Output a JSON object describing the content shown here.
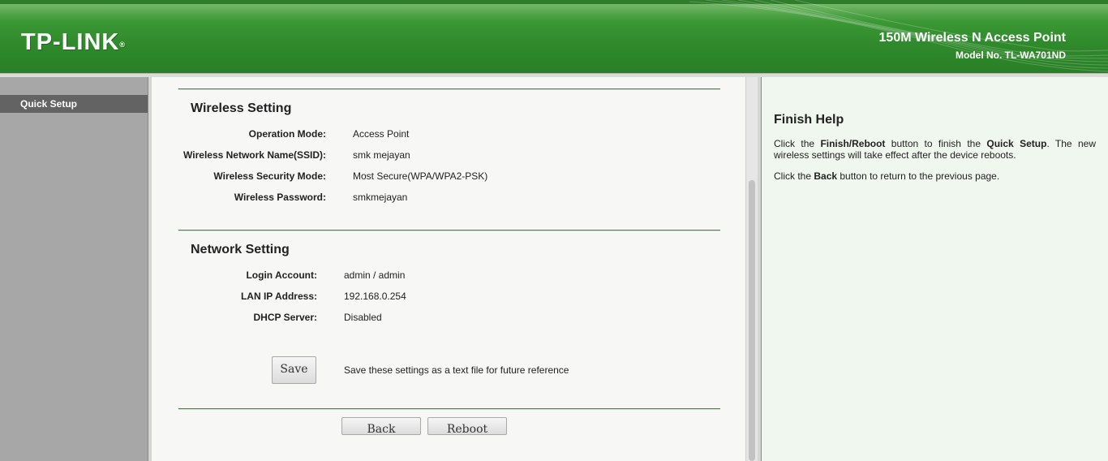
{
  "header": {
    "logo": "TP-LINK",
    "logo_mark": "®",
    "product_name": "150M Wireless N Access Point",
    "model": "Model No. TL-WA701ND"
  },
  "menu": {
    "items": [
      {
        "label": "Quick Setup",
        "active": true
      }
    ]
  },
  "wireless": {
    "title": "Wireless Setting",
    "rows": [
      {
        "label": "Operation Mode:",
        "value": "Access Point"
      },
      {
        "label": "Wireless Network Name(SSID):",
        "value": "smk mejayan"
      },
      {
        "label": "Wireless Security Mode:",
        "value": "Most Secure(WPA/WPA2-PSK)"
      },
      {
        "label": "Wireless Password:",
        "value": "smkmejayan"
      }
    ]
  },
  "network": {
    "title": "Network Setting",
    "rows": [
      {
        "label": "Login Account:",
        "value": "admin / admin"
      },
      {
        "label": "LAN IP Address:",
        "value": "192.168.0.254"
      },
      {
        "label": "DHCP Server:",
        "value": "Disabled"
      }
    ]
  },
  "save": {
    "button_label": "Save",
    "description": "Save these settings as a text file for future reference"
  },
  "footer_buttons": {
    "back": "Back",
    "reboot": "Reboot"
  },
  "help": {
    "title": "Finish Help",
    "p1": {
      "t1": "Click the ",
      "b1": "Finish/Reboot",
      "t2": " button to finish the ",
      "b2": "Quick Setup",
      "t3": ". The new wireless settings will take effect after the device reboots."
    },
    "p2": {
      "t1": "Click the ",
      "b1": "Back",
      "t2": " button to return to the previous page."
    }
  },
  "colors": {
    "header_green": "#2f8a2b",
    "menu_active": "#636363",
    "rule_green": "#3d8a3a",
    "help_bg": "#f0f7ee"
  }
}
